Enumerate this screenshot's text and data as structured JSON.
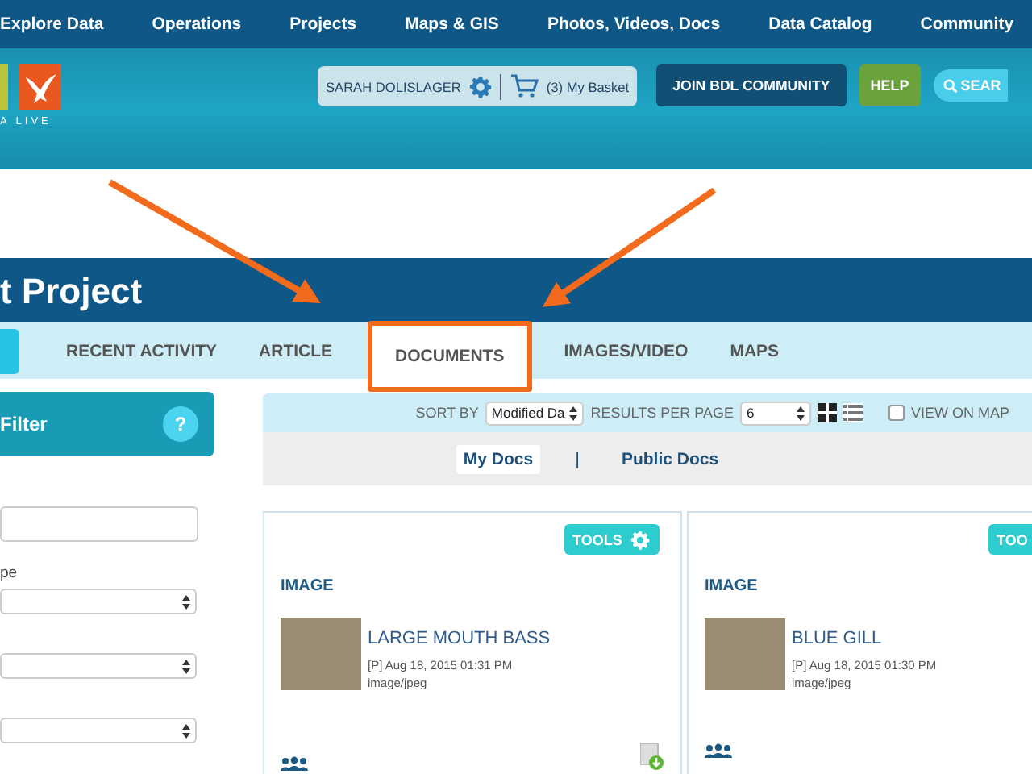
{
  "nav": [
    "Explore Data",
    "Operations",
    "Projects",
    "Maps & GIS",
    "Photos, Videos, Docs",
    "Data Catalog",
    "Community"
  ],
  "header": {
    "logo_text": "A LIVE",
    "user": "SARAH DOLISLAGER",
    "basket": "(3) My Basket",
    "join_button": "JOIN BDL COMMUNITY",
    "help_button": "HELP",
    "search_button": "SEAR"
  },
  "page_title": "t Project",
  "tabs": [
    {
      "label": "RECENT ACTIVITY",
      "selected": false,
      "highlighted": false
    },
    {
      "label": "ARTICLE",
      "selected": false,
      "highlighted": false
    },
    {
      "label": "DOCUMENTS",
      "selected": true,
      "highlighted": true
    },
    {
      "label": "IMAGES/VIDEO",
      "selected": false,
      "highlighted": false
    },
    {
      "label": "MAPS",
      "selected": false,
      "highlighted": false
    }
  ],
  "filter": {
    "title": "Filter",
    "help": "?",
    "fields": [
      {
        "kind": "input"
      },
      {
        "kind": "select",
        "label": "pe"
      },
      {
        "kind": "select"
      },
      {
        "kind": "select"
      }
    ]
  },
  "toolbar": {
    "sort_label": "SORT BY",
    "sort_value": "Modified Da",
    "per_page_label": "RESULTS PER PAGE",
    "per_page_value": "6",
    "views": [
      {
        "kind": "grid",
        "selected": true
      },
      {
        "kind": "list",
        "selected": false
      }
    ],
    "view_on_map": {
      "label": "VIEW ON MAP",
      "checked": false
    }
  },
  "doc_tabs": [
    {
      "label": "My Docs",
      "selected": true
    },
    {
      "label": "Public Docs",
      "selected": false
    }
  ],
  "doc_tabs_separator": "|",
  "cards": [
    {
      "tools": "TOOLS",
      "type": "IMAGE",
      "title": "LARGE MOUTH BASS",
      "date": "[P] Aug 18, 2015 01:31 PM",
      "mime": "image/jpeg",
      "download": true
    },
    {
      "tools": "TOO",
      "type": "IMAGE",
      "title": "BLUE GILL",
      "date": "[P] Aug 18, 2015 01:30 PM",
      "mime": "image/jpeg",
      "download": false
    }
  ]
}
